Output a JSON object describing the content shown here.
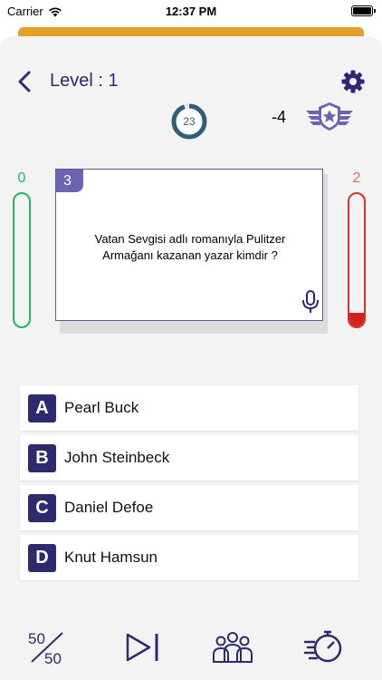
{
  "status_bar": {
    "carrier": "Carrier",
    "time": "12:37 PM"
  },
  "header": {
    "level_label": "Level : 1"
  },
  "timer": {
    "value": "23",
    "progress": 0.95
  },
  "score": {
    "delta": "-4"
  },
  "counters": {
    "correct": "0",
    "wrong": "2",
    "correct_level": 0.0,
    "wrong_level": 0.1
  },
  "question": {
    "number": "3",
    "text": "Vatan Sevgisi adlı romanıyla Pulitzer Armağanı kazanan yazar kimdir ?"
  },
  "answers": [
    {
      "letter": "A",
      "text": "Pearl Buck"
    },
    {
      "letter": "B",
      "text": "John Steinbeck"
    },
    {
      "letter": "C",
      "text": "Daniel Defoe"
    },
    {
      "letter": "D",
      "text": "Knut Hamsun"
    }
  ],
  "toolbar": {
    "fifty_top": "50",
    "fifty_bottom": "50",
    "icons": [
      "fifty-fifty-icon",
      "skip-icon",
      "audience-icon",
      "time-extend-icon"
    ]
  },
  "colors": {
    "primary": "#2e2a6e",
    "accent_orange": "#e2a22a",
    "correct": "#26b45f",
    "wrong": "#d2221c",
    "timer_ring": "#2e5f78",
    "card_number": "#6c63b1"
  }
}
